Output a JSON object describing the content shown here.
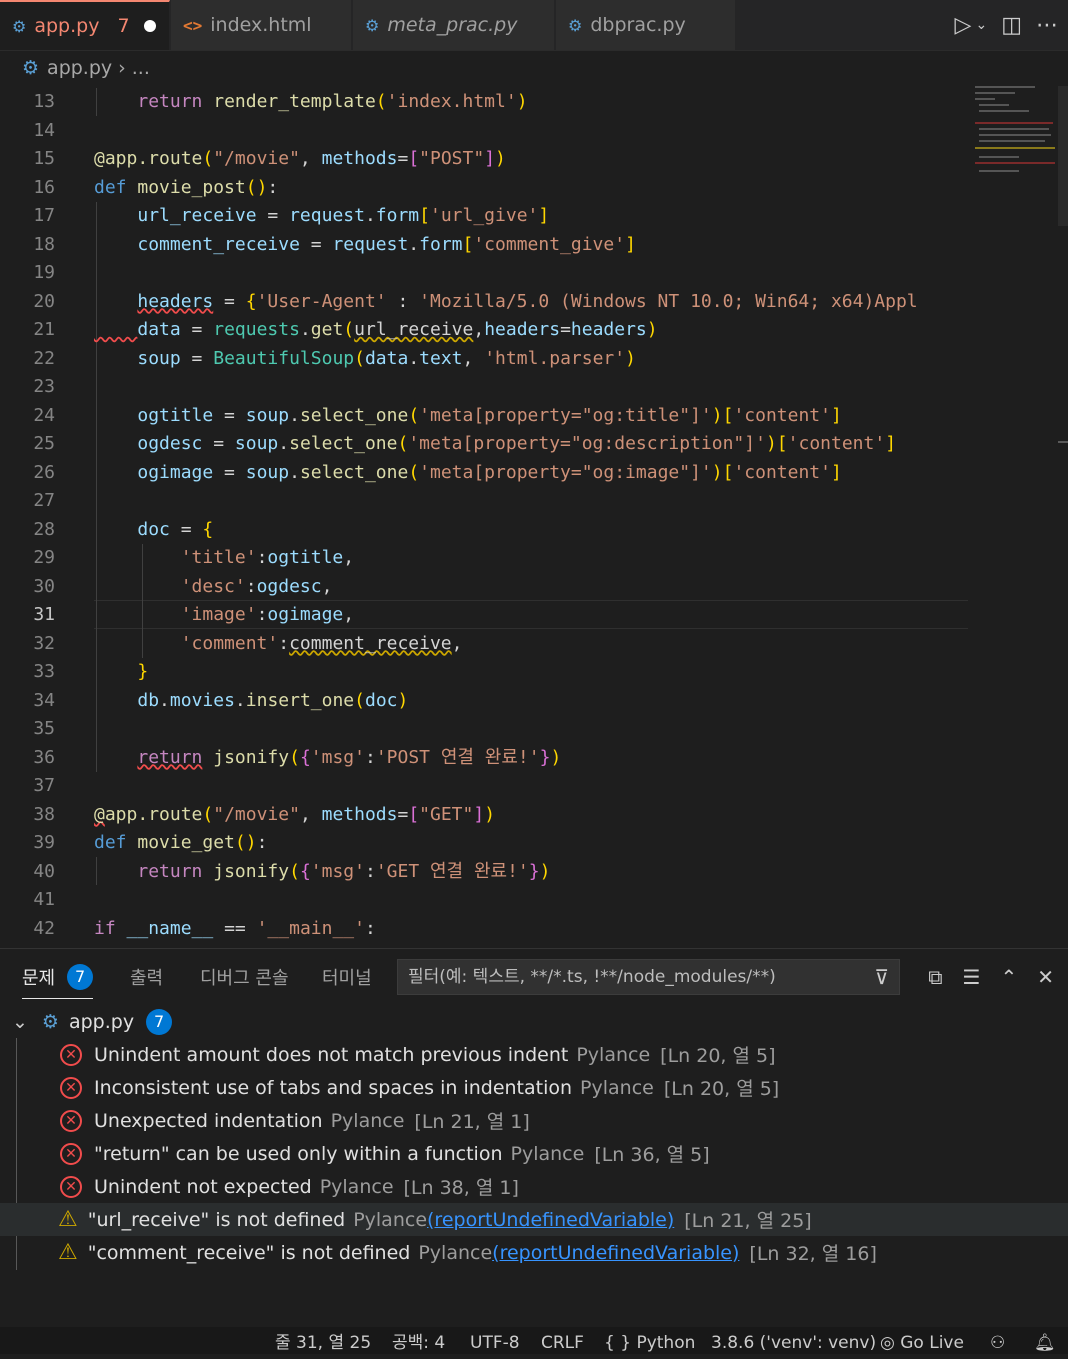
{
  "tabs": [
    {
      "label": "app.py",
      "count": "7",
      "modified": true
    },
    {
      "label": "index.html"
    },
    {
      "label": "meta_prac.py"
    },
    {
      "label": "dbprac.py"
    }
  ],
  "breadcrumb": {
    "file": "app.py",
    "sep": "›",
    "more": "..."
  },
  "editor": {
    "current_line": "31",
    "line_numbers": [
      "13",
      "14",
      "15",
      "16",
      "17",
      "18",
      "19",
      "20",
      "21",
      "22",
      "23",
      "24",
      "25",
      "26",
      "27",
      "28",
      "29",
      "30",
      "31",
      "32",
      "33",
      "34",
      "35",
      "36",
      "37",
      "38",
      "39",
      "40",
      "41",
      "42"
    ]
  },
  "panel": {
    "tabs": {
      "problems": "문제",
      "problems_count": "7",
      "output": "출력",
      "debug_console": "디버그 콘솔",
      "terminal": "터미널"
    },
    "filter_placeholder": "필터(예: 텍스트, **/*.ts, !**/node_modules/**)",
    "file_group": {
      "name": "app.py",
      "count": "7"
    },
    "problems": [
      {
        "severity": "error",
        "message": "Unindent amount does not match previous indent",
        "source": "Pylance",
        "code": "",
        "location": "[Ln 20, 열 5]"
      },
      {
        "severity": "error",
        "message": "Inconsistent use of tabs and spaces in indentation",
        "source": "Pylance",
        "code": "",
        "location": "[Ln 20, 열 5]"
      },
      {
        "severity": "error",
        "message": "Unexpected indentation",
        "source": "Pylance",
        "code": "",
        "location": "[Ln 21, 열 1]"
      },
      {
        "severity": "error",
        "message": "\"return\" can be used only within a function",
        "source": "Pylance",
        "code": "",
        "location": "[Ln 36, 열 5]"
      },
      {
        "severity": "error",
        "message": "Unindent not expected",
        "source": "Pylance",
        "code": "",
        "location": "[Ln 38, 열 1]"
      },
      {
        "severity": "warning",
        "message": "\"url_receive\" is not defined",
        "source": "Pylance",
        "code": "(reportUndefinedVariable)",
        "location": "[Ln 21, 열 25]"
      },
      {
        "severity": "warning",
        "message": "\"comment_receive\" is not defined",
        "source": "Pylance",
        "code": "(reportUndefinedVariable)",
        "location": "[Ln 32, 열 16]"
      }
    ]
  },
  "statusbar": {
    "position": "줄 31, 열 25",
    "spaces": "공백: 4",
    "encoding": "UTF-8",
    "eol": "CRLF",
    "language": "Python",
    "interpreter": "3.8.6 ('venv': venv)",
    "golive": "Go Live"
  },
  "colors": {
    "error": "#f14c4c",
    "warning": "#cca700",
    "badge": "#0078d4",
    "active_tab_text": "#f48771"
  }
}
